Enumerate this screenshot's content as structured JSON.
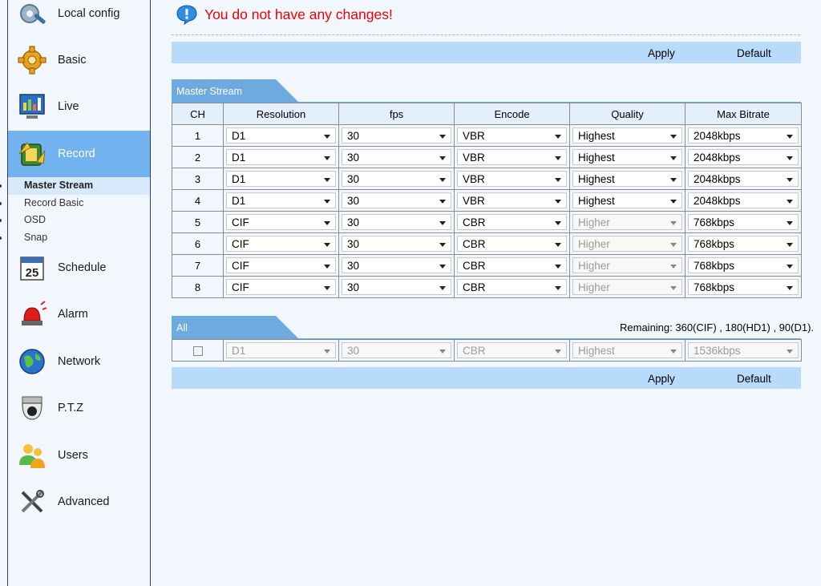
{
  "sidebar": {
    "items": [
      {
        "name": "local-config",
        "label": "Local config",
        "icon": "gear-wrench-icon"
      },
      {
        "name": "basic",
        "label": "Basic",
        "icon": "gear-icon"
      },
      {
        "name": "live",
        "label": "Live",
        "icon": "monitor-chart-icon"
      },
      {
        "name": "record",
        "label": "Record",
        "icon": "film-icon"
      },
      {
        "name": "schedule",
        "label": "Schedule",
        "icon": "calendar-icon"
      },
      {
        "name": "alarm",
        "label": "Alarm",
        "icon": "siren-icon"
      },
      {
        "name": "network",
        "label": "Network",
        "icon": "globe-icon"
      },
      {
        "name": "ptz",
        "label": "P.T.Z",
        "icon": "dome-camera-icon"
      },
      {
        "name": "users",
        "label": "Users",
        "icon": "users-icon"
      },
      {
        "name": "advanced",
        "label": "Advanced",
        "icon": "tools-icon"
      }
    ],
    "calendar_day": "25",
    "sub_items": [
      "Master Stream",
      "Record Basic",
      "OSD",
      "Snap"
    ]
  },
  "notice": {
    "text": "You do not have any changes!"
  },
  "buttons": {
    "apply": "Apply",
    "default": "Default"
  },
  "master": {
    "tab_label": "Master Stream",
    "headers": [
      "CH",
      "Resolution",
      "fps",
      "Encode",
      "Quality",
      "Max Bitrate"
    ],
    "rows": [
      {
        "ch": "1",
        "res": "D1",
        "fps": "30",
        "enc": "VBR",
        "qual": "Highest",
        "bitrate": "2048kbps"
      },
      {
        "ch": "2",
        "res": "D1",
        "fps": "30",
        "enc": "VBR",
        "qual": "Highest",
        "bitrate": "2048kbps"
      },
      {
        "ch": "3",
        "res": "D1",
        "fps": "30",
        "enc": "VBR",
        "qual": "Highest",
        "bitrate": "2048kbps"
      },
      {
        "ch": "4",
        "res": "D1",
        "fps": "30",
        "enc": "VBR",
        "qual": "Highest",
        "bitrate": "2048kbps"
      },
      {
        "ch": "5",
        "res": "CIF",
        "fps": "30",
        "enc": "CBR",
        "qual": "Higher",
        "bitrate": "768kbps"
      },
      {
        "ch": "6",
        "res": "CIF",
        "fps": "30",
        "enc": "CBR",
        "qual": "Higher",
        "bitrate": "768kbps"
      },
      {
        "ch": "7",
        "res": "CIF",
        "fps": "30",
        "enc": "CBR",
        "qual": "Higher",
        "bitrate": "768kbps"
      },
      {
        "ch": "8",
        "res": "CIF",
        "fps": "30",
        "enc": "CBR",
        "qual": "Higher",
        "bitrate": "768kbps"
      }
    ]
  },
  "all": {
    "tab_label": "All",
    "remaining": "Remaining: 360(CIF) , 180(HD1) , 90(D1).",
    "row": {
      "res": "D1",
      "fps": "30",
      "enc": "CBR",
      "qual": "Highest",
      "bitrate": "1536kbps"
    }
  },
  "colors": {
    "accent": "#71b2ef",
    "bar": "#b8dafb",
    "notice": "#ee0000",
    "sidebar_border": "#2e3f5f"
  }
}
